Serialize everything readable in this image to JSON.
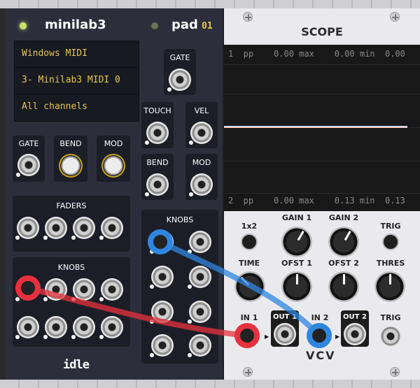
{
  "minilab": {
    "title": "minilab3",
    "pad_label": "pad",
    "pad_number": "01",
    "midi": {
      "driver": "Windows MIDI",
      "device": "3- Minilab3 MIDI 0",
      "channel": "All channels"
    },
    "left_labels": {
      "gate": "GATE",
      "bend": "BEND",
      "mod": "MOD"
    },
    "pad_labels": {
      "gate": "GATE",
      "touch": "TOUCH",
      "vel": "VEL",
      "bend": "BEND",
      "mod": "MOD"
    },
    "faders_label": "FADERS",
    "knobs_label": "KNOBS",
    "right_knobs_label": "KNOBS",
    "brand": "idle",
    "knob_ring_color": "#c9a21a"
  },
  "scope": {
    "title": "SCOPE",
    "ch1_readout": "1  pp    0.00 max    0.00 min  0.00",
    "ch2_readout": "2  pp    0.00 max    0.13 min  0.13",
    "labels": {
      "x1x2": "1x2",
      "gain1": "GAIN 1",
      "gain2": "GAIN 2",
      "trig_btn": "TRIG",
      "time": "TIME",
      "ofst1": "OFST 1",
      "ofst2": "OFST 2",
      "thres": "THRES",
      "in1": "IN 1",
      "out1": "OUT 1",
      "in2": "IN 2",
      "out2": "OUT 2",
      "trig_in": "TRIG"
    },
    "brand": "VCV"
  },
  "cables": {
    "red": "#e8313e",
    "blue": "#2f86e0"
  }
}
